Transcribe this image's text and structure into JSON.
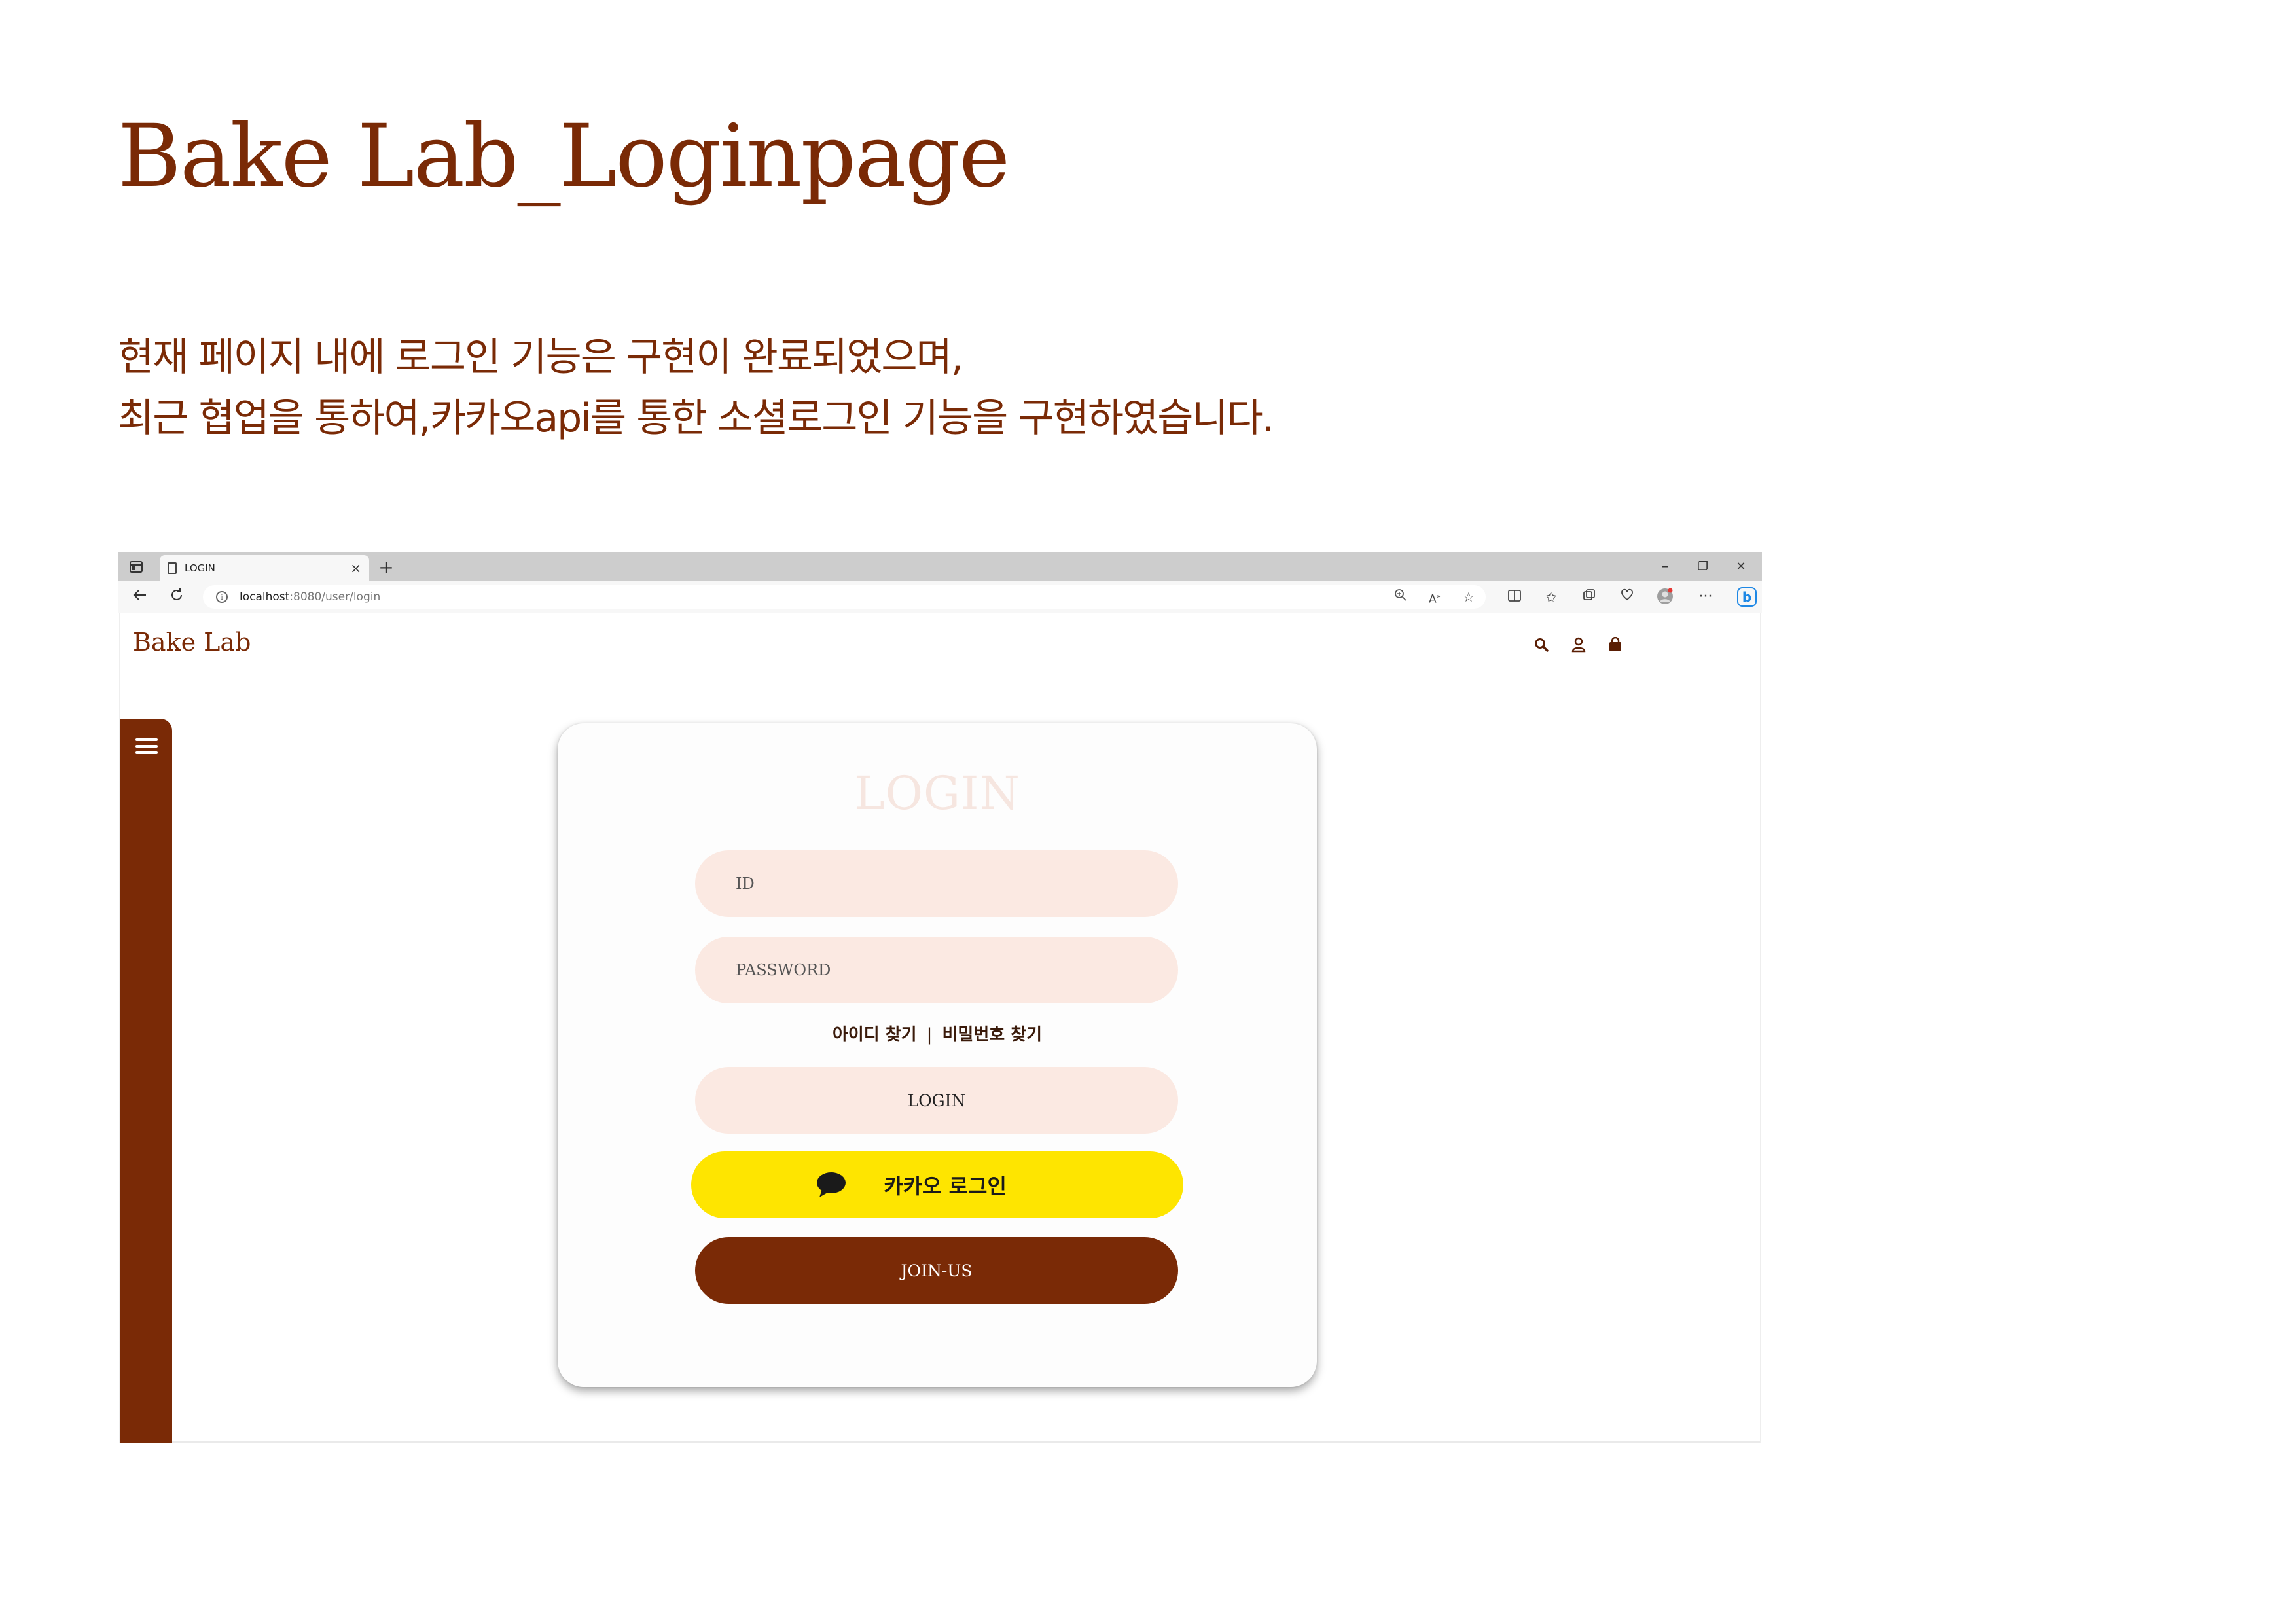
{
  "page": {
    "title": "Bake Lab_Loginpage",
    "description": [
      "현재 페이지 내에 로그인 기능은 구현이 완료되었으며,",
      "최근 협업을 통하여,카카오api를 통한 소셜로그인 기능을 구현하였습니다."
    ]
  },
  "browser": {
    "tab_title": "LOGIN",
    "tab_close": "×",
    "new_tab": "+",
    "window_controls": [
      "–",
      "❐",
      "✕"
    ],
    "url_host": "localhost",
    "url_rest": ":8080/user/login",
    "toolbar_icons": [
      "zoom-icon",
      "read-aloud-icon",
      "favorite-star-icon",
      "split-screen-icon",
      "favorites-icon",
      "collections-icon",
      "extensions-icon",
      "profile-icon",
      "more-icon",
      "bing-icon"
    ]
  },
  "site": {
    "brand": "Bake Lab",
    "login": {
      "heading": "LOGIN",
      "id_placeholder": "ID",
      "password_placeholder": "PASSWORD",
      "find_id": "아이디 찾기",
      "separator": "|",
      "find_password": "비밀번호 찾기",
      "login_button": "LOGIN",
      "kakao_button": "카카오 로그인",
      "join_button": "JOIN-US"
    }
  },
  "colors": {
    "brand_brown": "#7a2a06",
    "input_pink": "#fbe9e2",
    "kakao_yellow": "#fee500"
  }
}
